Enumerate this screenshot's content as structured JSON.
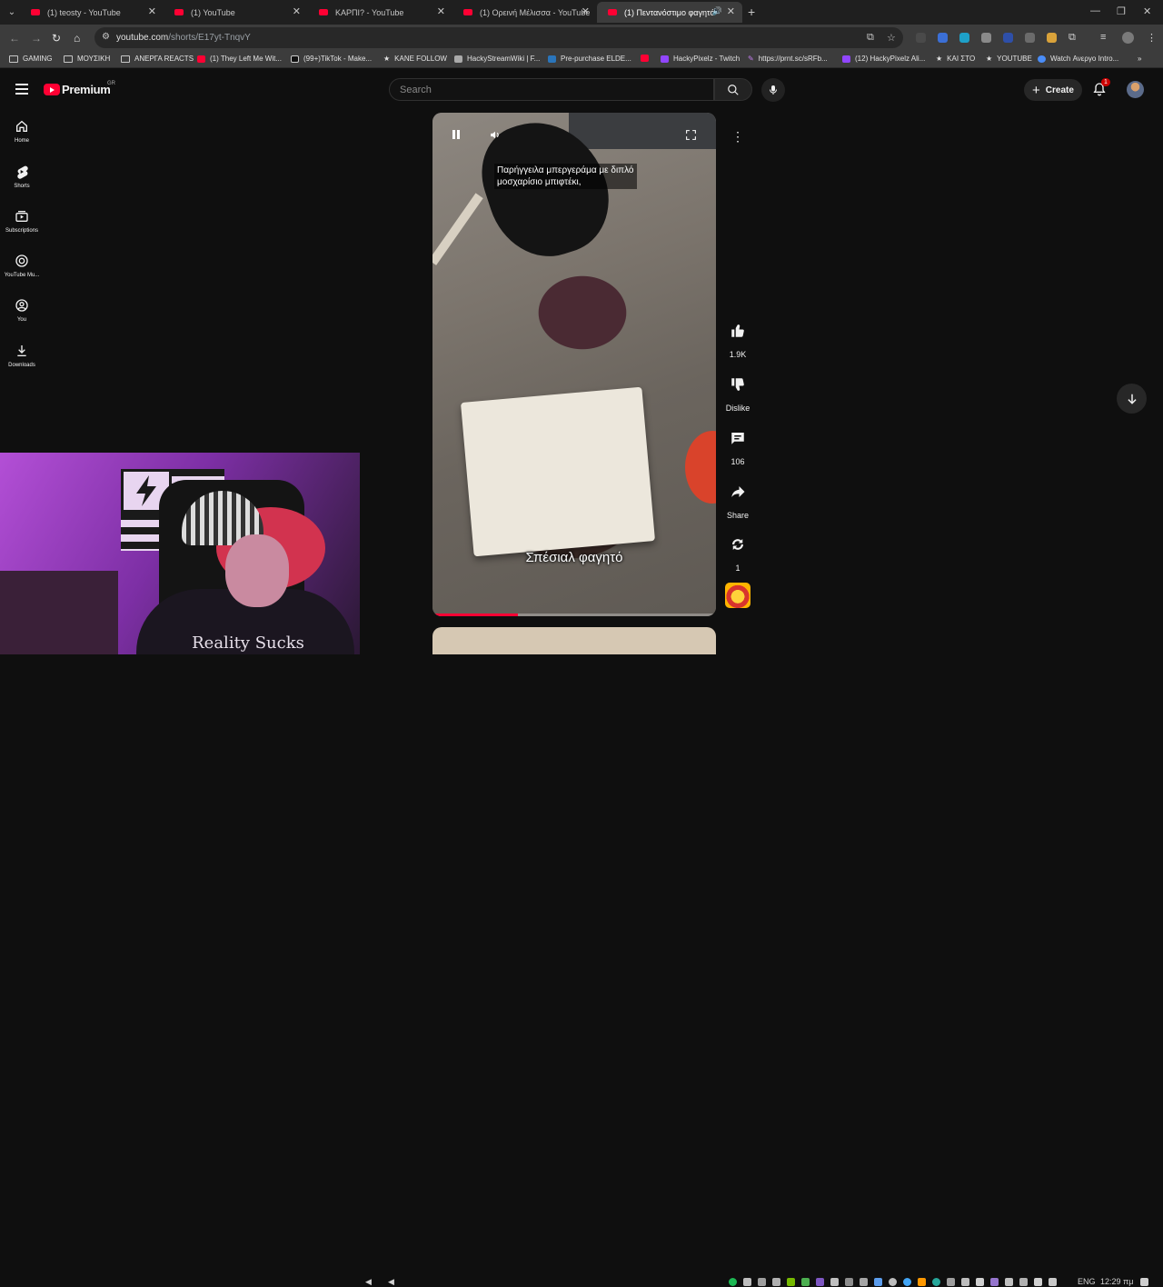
{
  "browser": {
    "tabs": [
      {
        "title": "(1) teosty - YouTube"
      },
      {
        "title": "(1) YouTube"
      },
      {
        "title": "ΚΑΡΠΙ? - YouTube"
      },
      {
        "title": "(1) Ορεινή Μέλισσα - YouTube"
      },
      {
        "title": "(1) Πεντανόστιμο φαγητό"
      }
    ],
    "url_host": "youtube.com",
    "url_path": "/shorts/E17yt-TnqvY",
    "bookmarks": [
      "GAMING",
      "ΜΟΥΣΙΚΗ",
      "ΑΝΕΡΓΑ REACTS",
      "(1) They Left Me Wit...",
      "(99+)TikTok - Make...",
      "KANE FOLLOW",
      "HackyStreamWiki | F...",
      "Pre-purchase ELDE...",
      "HackyPixelz - Twitch",
      "https://prnt.sc/sRFb...",
      "(12) HackyPixelz Ali...",
      "ΚΑΙ ΣΤΟ",
      "YOUTUBE",
      "Watch Ανεργο Intro..."
    ]
  },
  "youtube": {
    "logo_text": "Premium",
    "country_code": "GR",
    "search_placeholder": "Search",
    "create_label": "Create",
    "notification_count": "1",
    "sidebar": [
      {
        "label": "Home",
        "icon": "home-icon"
      },
      {
        "label": "Shorts",
        "icon": "shorts-icon"
      },
      {
        "label": "Subscriptions",
        "icon": "subscriptions-icon"
      },
      {
        "label": "YouTube Mu...",
        "icon": "youtube-music-icon"
      },
      {
        "label": "You",
        "icon": "you-icon"
      },
      {
        "label": "Downloads",
        "icon": "download-icon"
      }
    ]
  },
  "short": {
    "caption_top_line1": "Παρήγγειλα μπεργεράμα με διπλό",
    "caption_top_line2": "μοσχαρίσιο μπιφτέκι,",
    "caption_bottom": "Σπέσιαλ φαγητό",
    "progress_fraction": 0.3,
    "actions": {
      "likes": "1.9K",
      "dislike_label": "Dislike",
      "comments": "106",
      "share_label": "Share",
      "remix_count": "1"
    }
  },
  "webcam": {
    "shirt_text": "Reality Sucks"
  },
  "taskbar": {
    "language": "ENG",
    "time": "12:29 πμ"
  },
  "colors": {
    "youtube_red": "#ff0033",
    "background": "#0f0f0f"
  }
}
